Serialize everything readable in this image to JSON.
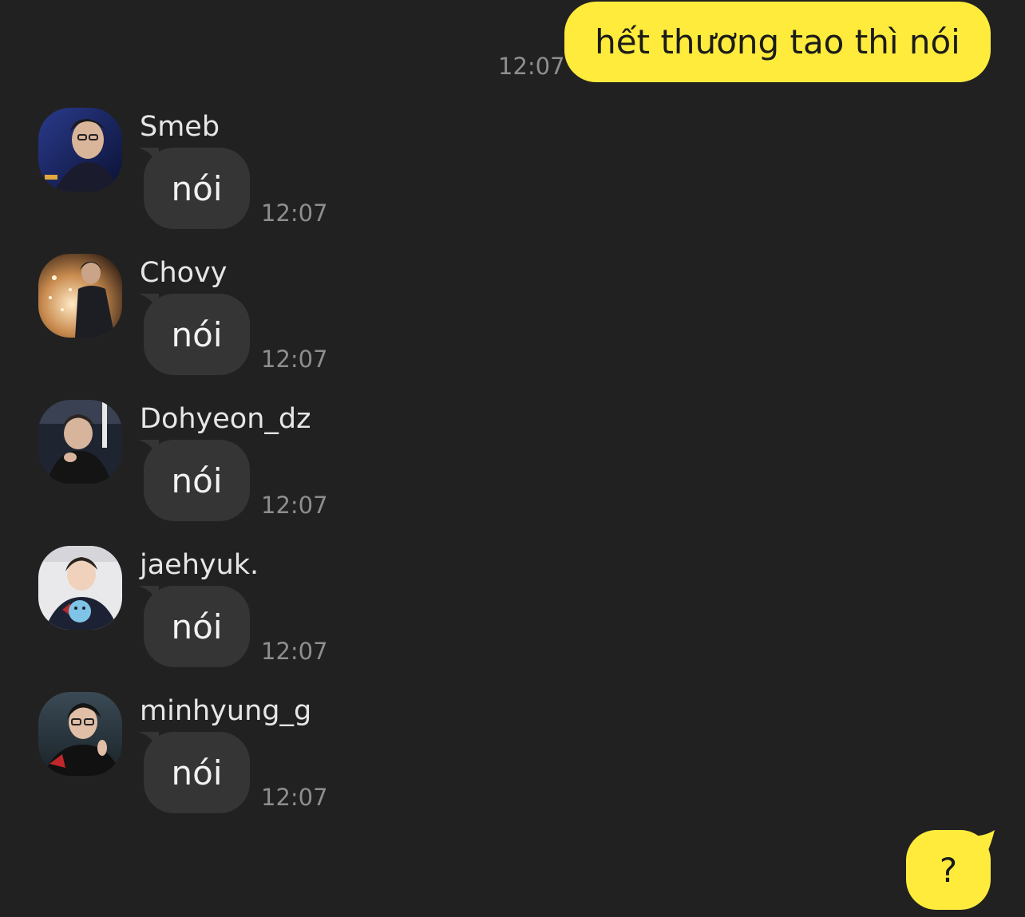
{
  "chat": {
    "outgoing_top": {
      "text": "hết thương tao thì nói",
      "time": "12:07"
    },
    "messages": [
      {
        "sender": "Smeb",
        "text": "nói",
        "time": "12:07"
      },
      {
        "sender": "Chovy",
        "text": "nói",
        "time": "12:07"
      },
      {
        "sender": "Dohyeon_dz",
        "text": "nói",
        "time": "12:07"
      },
      {
        "sender": "jaehyuk.",
        "text": "nói",
        "time": "12:07"
      },
      {
        "sender": "minhyung_g",
        "text": "nói",
        "time": "12:07"
      }
    ],
    "outgoing_bottom": {
      "text": "?"
    }
  },
  "colors": {
    "background": "#212121",
    "outgoing_bubble": "#ffeb3b",
    "incoming_bubble": "#353535",
    "timestamp": "#8e8e8e",
    "sender_name": "#e6e6e6"
  }
}
